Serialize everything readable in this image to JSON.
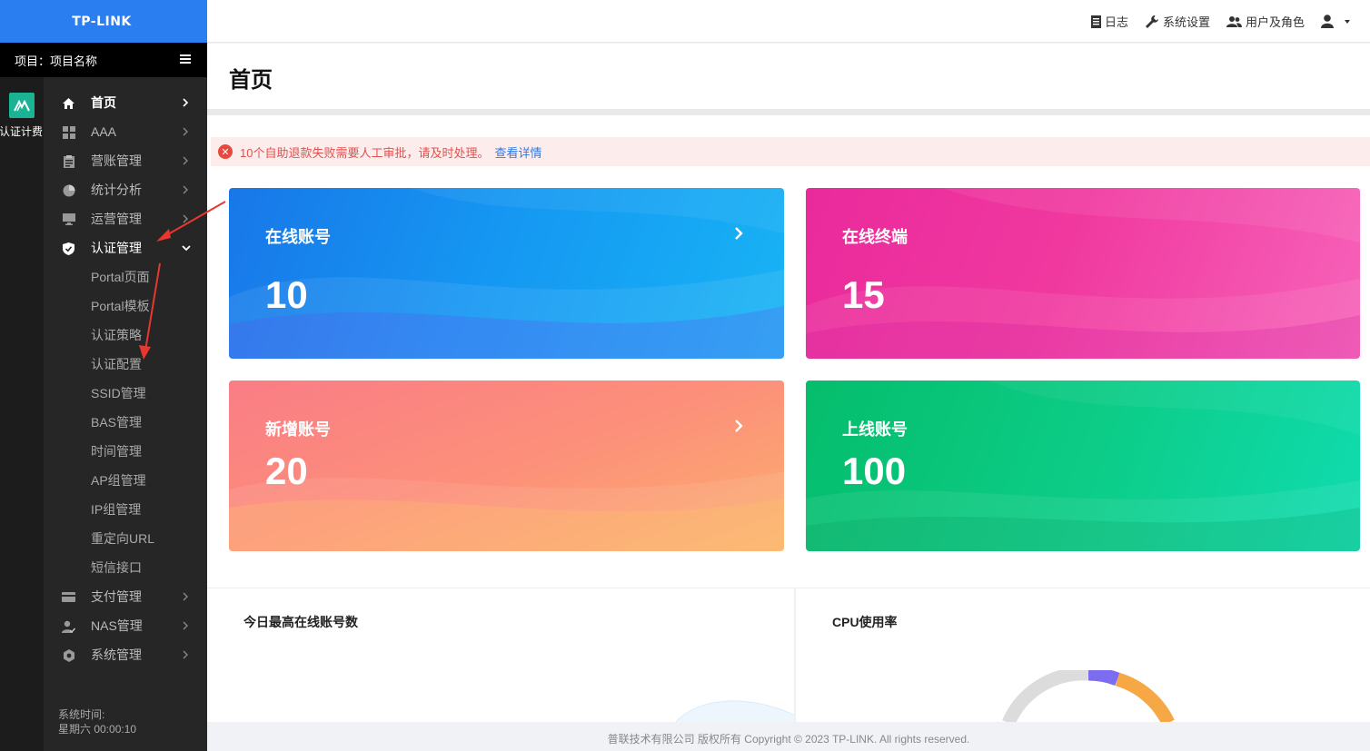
{
  "brand": {
    "logo_text": "TP-LINK"
  },
  "project": {
    "label": "项目：项目名称"
  },
  "rail": {
    "app_label": "认证计费"
  },
  "sidebar": {
    "items": [
      {
        "label": "首页",
        "icon": "home-icon"
      },
      {
        "label": "AAA",
        "icon": "grid-icon"
      },
      {
        "label": "营账管理",
        "icon": "clipboard-icon"
      },
      {
        "label": "统计分析",
        "icon": "pie-icon"
      },
      {
        "label": "运营管理",
        "icon": "monitor-icon"
      },
      {
        "label": "认证管理",
        "icon": "shield-icon"
      },
      {
        "label": "Portal页面"
      },
      {
        "label": "Portal模板"
      },
      {
        "label": "认证策略"
      },
      {
        "label": "认证配置"
      },
      {
        "label": "SSID管理"
      },
      {
        "label": "BAS管理"
      },
      {
        "label": "时间管理"
      },
      {
        "label": "AP组管理"
      },
      {
        "label": "IP组管理"
      },
      {
        "label": "重定向URL"
      },
      {
        "label": "短信接口"
      },
      {
        "label": "支付管理",
        "icon": "card-icon"
      },
      {
        "label": "NAS管理",
        "icon": "user-check-icon"
      },
      {
        "label": "系统管理",
        "icon": "gear-icon"
      }
    ]
  },
  "system_time": {
    "label": "系统时间:",
    "value": "星期六 00:00:10"
  },
  "topbar": {
    "log": "日志",
    "settings": "系统设置",
    "users": "用户及角色"
  },
  "page": {
    "title": "首页"
  },
  "alert": {
    "message": "10个自助退款失败需要人工审批，请及时处理。",
    "link": "查看详情"
  },
  "cards": [
    {
      "title": "在线账号",
      "value": "10",
      "color": "#1a8cf0"
    },
    {
      "title": "在线终端",
      "value": "15",
      "color": "#ef34a0"
    },
    {
      "title": "新增账号",
      "value": "20",
      "color": "#fc8d7d"
    },
    {
      "title": "上线账号",
      "value": "100",
      "color": "#0bc97f"
    }
  ],
  "panels": {
    "left_title": "今日最高在线账号数",
    "right_title": "CPU使用率"
  },
  "footer": {
    "text": "普联技术有限公司 版权所有 Copyright © 2023 TP-LINK. All rights reserved."
  },
  "chart_data": {
    "type": "pie",
    "title": "CPU使用率",
    "note": "donut chart partially visible; visible segments: gray background, purple and orange segments",
    "series": [
      {
        "color": "#7b6cf0"
      },
      {
        "color": "#f5a843"
      },
      {
        "color": "#dcdcdc"
      }
    ]
  }
}
